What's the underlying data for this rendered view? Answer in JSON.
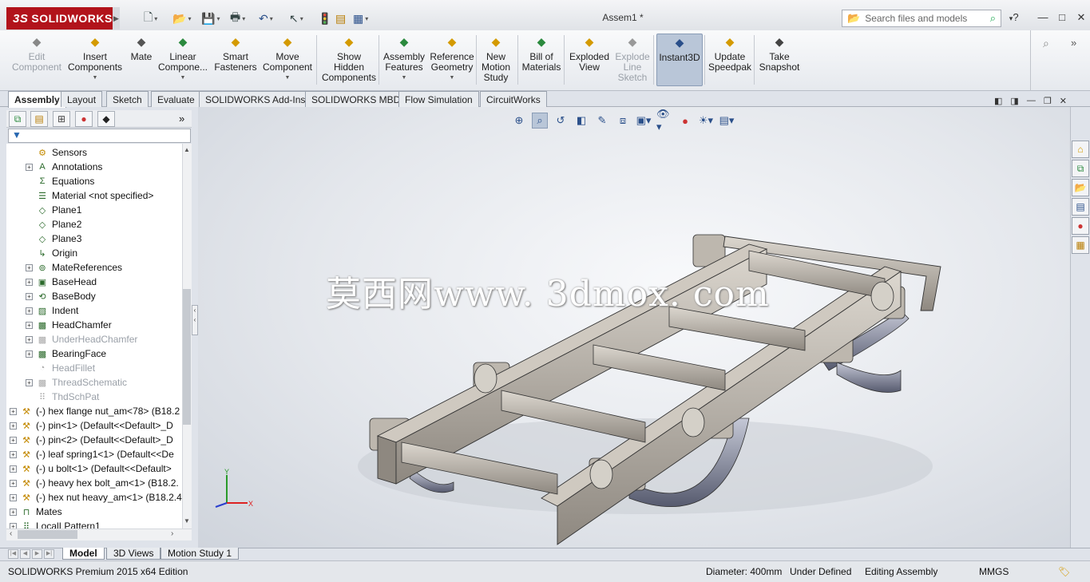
{
  "app": {
    "logo_text": "SOLIDWORKS",
    "logo_prefix": "3S",
    "document_title": "Assem1 *"
  },
  "search": {
    "placeholder": "Search files and models"
  },
  "window_buttons": [
    "?",
    "—",
    "□",
    "✕"
  ],
  "commands": [
    {
      "label": "Edit\nComponent",
      "icon": "edit-component-icon",
      "disabled": true
    },
    {
      "label": "Insert\nComponents",
      "icon": "insert-components-icon",
      "dropdown": true
    },
    {
      "label": "Mate",
      "icon": "mate-icon"
    },
    {
      "label": "Linear\nCompone...",
      "icon": "linear-pattern-icon",
      "dropdown": true
    },
    {
      "label": "Smart\nFasteners",
      "icon": "smart-fasteners-icon"
    },
    {
      "label": "Move\nComponent",
      "icon": "move-component-icon",
      "dropdown": true
    },
    {
      "label": "Show\nHidden\nComponents",
      "icon": "show-hidden-icon"
    },
    {
      "label": "Assembly\nFeatures",
      "icon": "assembly-features-icon",
      "dropdown": true
    },
    {
      "label": "Reference\nGeometry",
      "icon": "reference-geometry-icon",
      "dropdown": true
    },
    {
      "label": "New\nMotion\nStudy",
      "icon": "motion-study-icon"
    },
    {
      "label": "Bill of\nMaterials",
      "icon": "bill-of-materials-icon"
    },
    {
      "label": "Exploded\nView",
      "icon": "exploded-view-icon"
    },
    {
      "label": "Explode\nLine\nSketch",
      "icon": "explode-line-icon",
      "disabled": true
    },
    {
      "label": "Instant3D",
      "icon": "instant3d-icon",
      "active": true
    },
    {
      "label": "Update\nSpeedpak",
      "icon": "speedpak-icon"
    },
    {
      "label": "Take\nSnapshot",
      "icon": "snapshot-icon"
    }
  ],
  "tabs": [
    "Assembly",
    "Layout",
    "Sketch",
    "Evaluate",
    "SOLIDWORKS Add-Ins",
    "SOLIDWORKS MBD",
    "Flow Simulation",
    "CircuitWorks"
  ],
  "selected_tab": "Assembly",
  "tree": [
    {
      "label": "Sensors",
      "icon": "sensor-icon"
    },
    {
      "label": "Annotations",
      "icon": "annotations-icon",
      "expand": true
    },
    {
      "label": "Equations",
      "icon": "equations-icon"
    },
    {
      "label": "Material <not specified>",
      "icon": "material-icon"
    },
    {
      "label": "Plane1",
      "icon": "plane-icon"
    },
    {
      "label": "Plane2",
      "icon": "plane-icon"
    },
    {
      "label": "Plane3",
      "icon": "plane-icon"
    },
    {
      "label": "Origin",
      "icon": "origin-icon"
    },
    {
      "label": "MateReferences",
      "icon": "mate-references-icon",
      "expand": true
    },
    {
      "label": "BaseHead",
      "icon": "feature-icon",
      "expand": true
    },
    {
      "label": "BaseBody",
      "icon": "revolve-icon",
      "expand": true
    },
    {
      "label": "Indent",
      "icon": "indent-icon",
      "expand": true
    },
    {
      "label": "HeadChamfer",
      "icon": "cut-icon",
      "expand": true
    },
    {
      "label": "UnderHeadChamfer",
      "icon": "cut-icon",
      "expand": true,
      "grey": true
    },
    {
      "label": "BearingFace",
      "icon": "cut-icon",
      "expand": true
    },
    {
      "label": "HeadFillet",
      "icon": "fillet-icon",
      "grey": true
    },
    {
      "label": "ThreadSchematic",
      "icon": "cut-icon",
      "expand": true,
      "grey": true
    },
    {
      "label": "ThdSchPat",
      "icon": "pattern-icon",
      "grey": true
    },
    {
      "label": "(-) hex flange nut_am<78> (B18.2",
      "icon": "part-icon",
      "expand": true,
      "level": 0
    },
    {
      "label": "(-) pin<1> (Default<<Default>_D",
      "icon": "part-icon",
      "expand": true,
      "level": 0
    },
    {
      "label": "(-) pin<2> (Default<<Default>_D",
      "icon": "part-icon",
      "expand": true,
      "level": 0
    },
    {
      "label": "(-) leaf spring1<1> (Default<<De",
      "icon": "part-icon",
      "expand": true,
      "level": 0
    },
    {
      "label": "(-) u bolt<1> (Default<<Default>",
      "icon": "part-icon",
      "expand": true,
      "level": 0
    },
    {
      "label": "(-) heavy hex bolt_am<1> (B18.2.",
      "icon": "part-icon",
      "expand": true,
      "level": 0
    },
    {
      "label": "(-) hex nut heavy_am<1> (B18.2.4",
      "icon": "part-icon",
      "expand": true,
      "level": 0
    },
    {
      "label": "Mates",
      "icon": "mates-icon",
      "expand": true,
      "level": 0
    },
    {
      "label": "LocalLPattern1",
      "icon": "pattern-icon",
      "expand": true,
      "level": 0
    }
  ],
  "watermark": "莫西网www. 3dmox. com",
  "triad": {
    "x": "X",
    "y": "Y"
  },
  "bottom_tabs": [
    "Model",
    "3D Views",
    "Motion Study 1"
  ],
  "status": {
    "edition": "SOLIDWORKS Premium 2015 x64 Edition",
    "diameter": "Diameter: 400mm",
    "defined": "Under Defined",
    "mode": "Editing Assembly",
    "units": "MMGS"
  },
  "colors": {
    "brand": "#b2131b",
    "accent": "#2767b0"
  }
}
